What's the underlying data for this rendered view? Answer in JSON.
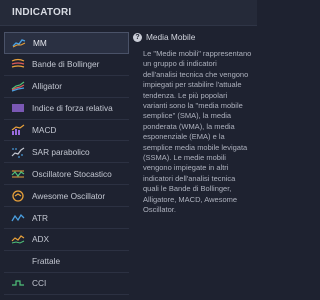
{
  "header": {
    "title": "INDICATORI"
  },
  "indicators": [
    {
      "label": "MM",
      "icon": "moving-average-icon"
    },
    {
      "label": "Bande di Bollinger",
      "icon": "bollinger-icon"
    },
    {
      "label": "Alligator",
      "icon": "alligator-icon"
    },
    {
      "label": "Indice di forza relativa",
      "icon": "rsi-icon"
    },
    {
      "label": "MACD",
      "icon": "macd-icon"
    },
    {
      "label": "SAR parabolico",
      "icon": "sar-icon"
    },
    {
      "label": "Oscillatore Stocastico",
      "icon": "stochastic-icon"
    },
    {
      "label": "Awesome Oscillator",
      "icon": "awesome-oscillator-icon"
    },
    {
      "label": "ATR",
      "icon": "atr-icon"
    },
    {
      "label": "ADX",
      "icon": "adx-icon"
    },
    {
      "label": "Frattale",
      "icon": "fractal-icon"
    },
    {
      "label": "CCI",
      "icon": "cci-icon"
    }
  ],
  "info": {
    "title": "Media Mobile",
    "description": "Le \"Medie mobili\" rappresentano un gruppo di indicatori dell'analisi tecnica che vengono impiegati per stabilire l'attuale tendenza. Le più popolari varianti sono la \"media mobile semplice\" (SMA), la media ponderata (WMA), la media esponenziale (EMA) e la semplice media mobile levigata (SSMA). Le medie mobili vengono impiegate in altri indicatori dell'analisi tecnica quali le Bande di Bollinger, Alligatore, MACD, Awesome Oscillator."
  },
  "colors": {
    "background": "#1e2230",
    "accent_blue": "#4a9fe0",
    "accent_orange": "#e8a13a",
    "accent_purple": "#9a6be0",
    "accent_green": "#4fc17a"
  }
}
